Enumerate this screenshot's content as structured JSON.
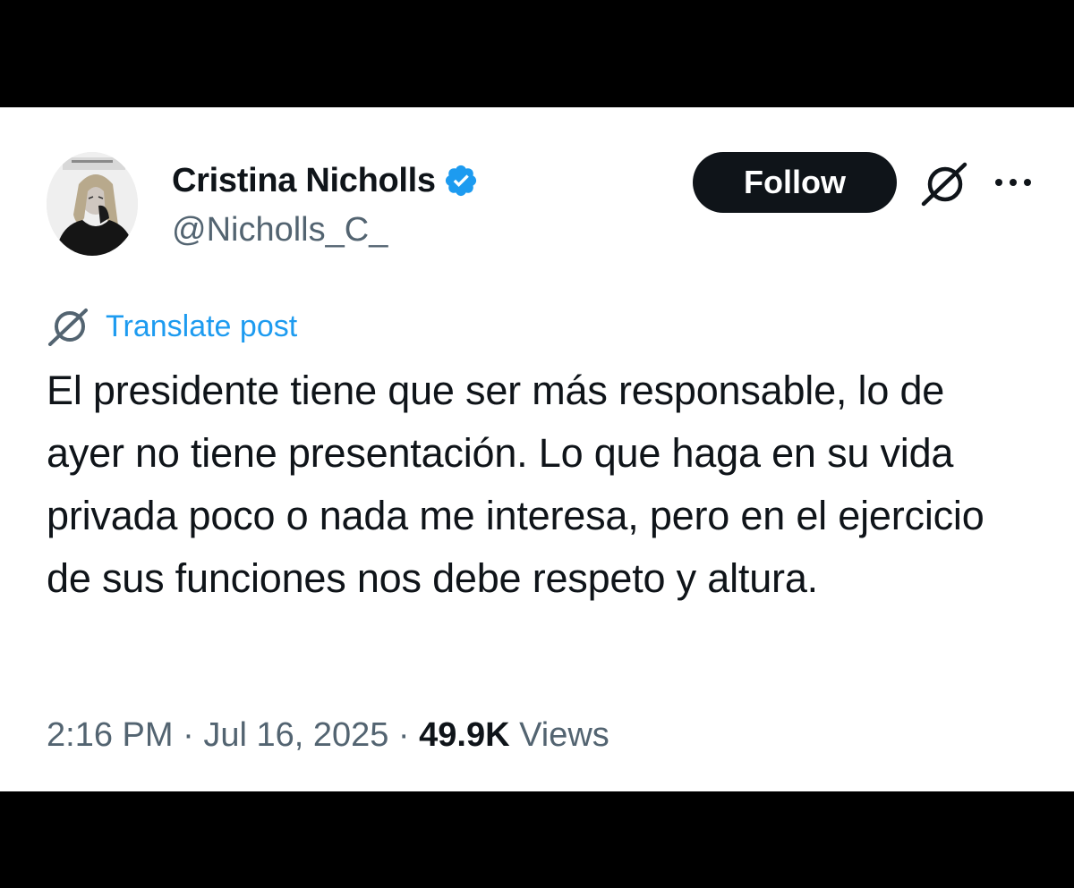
{
  "user": {
    "display_name": "Cristina Nicholls",
    "handle": "@Nicholls_C_",
    "verified": true
  },
  "actions": {
    "follow_label": "Follow",
    "grok_icon": "grok-slash-icon",
    "more_icon": "more-dots-icon"
  },
  "translate": {
    "label": "Translate post",
    "icon": "grok-slash-icon"
  },
  "post": {
    "text": "El presidente tiene que ser más responsable, lo de ayer no tiene presentación. Lo que haga en su vida privada poco o nada me interesa, pero en el ejercicio de sus funciones nos debe respeto y altura."
  },
  "meta": {
    "time": "2:16 PM",
    "separator": " · ",
    "date": "Jul 16, 2025",
    "views_count": "49.9K",
    "views_label": "Views"
  },
  "colors": {
    "background": "#000000",
    "card": "#ffffff",
    "text_primary": "#0f1419",
    "text_secondary": "#536471",
    "accent": "#1d9bf0",
    "follow_bg": "#0f1419"
  }
}
